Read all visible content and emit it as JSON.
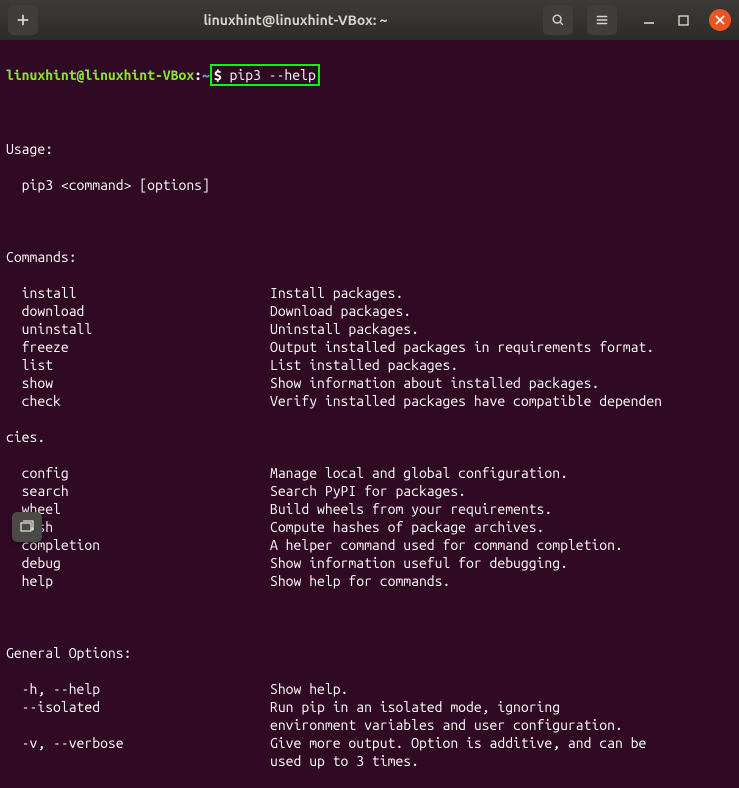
{
  "titlebar": {
    "title": "linuxhint@linuxhint-VBox: ~"
  },
  "prompt": {
    "user_host": "linuxhint@linuxhint-VBox",
    "colon": ":",
    "path": "~",
    "dollar": "$ ",
    "command": "pip3 --help"
  },
  "output": {
    "usage_header": "Usage:",
    "usage_line": "  pip3 <command> [options]",
    "commands_header": "Commands:",
    "commands": [
      {
        "name": "  install",
        "desc": "Install packages."
      },
      {
        "name": "  download",
        "desc": "Download packages."
      },
      {
        "name": "  uninstall",
        "desc": "Uninstall packages."
      },
      {
        "name": "  freeze",
        "desc": "Output installed packages in requirements format."
      },
      {
        "name": "  list",
        "desc": "List installed packages."
      },
      {
        "name": "  show",
        "desc": "Show information about installed packages."
      },
      {
        "name": "  check",
        "desc": "Verify installed packages have compatible dependen"
      }
    ],
    "check_wrap": "cies.",
    "commands2": [
      {
        "name": "  config",
        "desc": "Manage local and global configuration."
      },
      {
        "name": "  search",
        "desc": "Search PyPI for packages."
      },
      {
        "name": "  wheel",
        "desc": "Build wheels from your requirements."
      },
      {
        "name": "  hash",
        "desc": "Compute hashes of package archives."
      },
      {
        "name": "  completion",
        "desc": "A helper command used for command completion."
      },
      {
        "name": "  debug",
        "desc": "Show information useful for debugging."
      },
      {
        "name": "  help",
        "desc": "Show help for commands."
      }
    ],
    "options_header": "General Options:",
    "options": [
      {
        "name": "  -h, --help",
        "desc": "Show help."
      },
      {
        "name": "  --isolated",
        "desc": "Run pip in an isolated mode, ignoring"
      },
      {
        "name": "",
        "desc": "environment variables and user configuration."
      },
      {
        "name": "  -v, --verbose",
        "desc": "Give more output. Option is additive, and can be"
      },
      {
        "name": "",
        "desc": "used up to 3 times."
      }
    ]
  }
}
